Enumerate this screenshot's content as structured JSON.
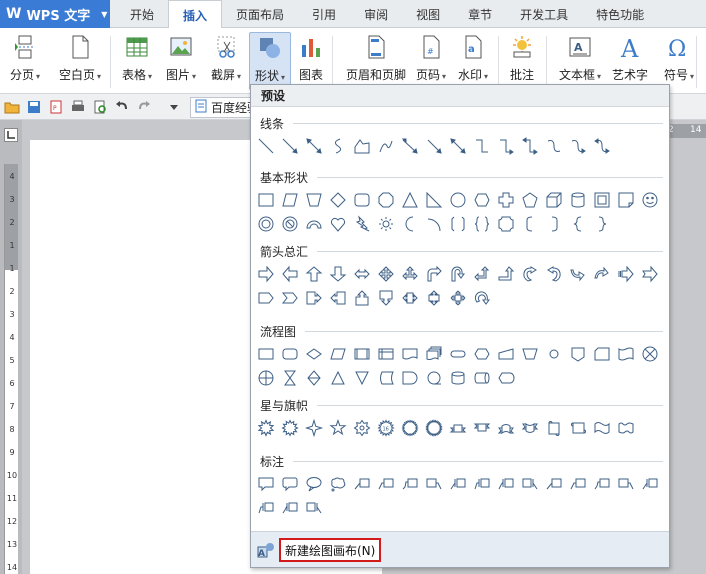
{
  "app": {
    "title": "WPS 文字"
  },
  "tabs": [
    "开始",
    "插入",
    "页面布局",
    "引用",
    "审阅",
    "视图",
    "章节",
    "开发工具",
    "特色功能"
  ],
  "active_tab": "插入",
  "ribbon": [
    {
      "label": "分页",
      "dropdown": true,
      "icon": "page-break-icon"
    },
    {
      "label": "空白页",
      "dropdown": true,
      "icon": "blank-page-icon"
    },
    {
      "label": "表格",
      "dropdown": true,
      "icon": "table-icon"
    },
    {
      "label": "图片",
      "dropdown": true,
      "icon": "picture-icon"
    },
    {
      "label": "截屏",
      "dropdown": true,
      "icon": "scissors-icon"
    },
    {
      "label": "形状",
      "dropdown": true,
      "icon": "shapes-icon"
    },
    {
      "label": "图表",
      "dropdown": false,
      "icon": "chart-icon"
    },
    {
      "label": "页眉和页脚",
      "dropdown": false,
      "icon": "header-footer-icon"
    },
    {
      "label": "页码",
      "dropdown": true,
      "icon": "page-number-icon"
    },
    {
      "label": "水印",
      "dropdown": true,
      "icon": "watermark-icon"
    },
    {
      "label": "批注",
      "dropdown": false,
      "icon": "comment-icon"
    },
    {
      "label": "文本框",
      "dropdown": true,
      "icon": "textbox-icon"
    },
    {
      "label": "艺术字",
      "dropdown": false,
      "icon": "wordart-icon"
    },
    {
      "label": "符号",
      "dropdown": true,
      "icon": "symbol-icon"
    }
  ],
  "quick_access": {
    "doc_tab": "百度经验"
  },
  "ruler": {
    "vertical_numbers": [
      "4",
      "3",
      "2",
      "1",
      "1",
      "2",
      "3",
      "4",
      "5",
      "6",
      "7",
      "8",
      "9",
      "10",
      "11",
      "12",
      "13",
      "14"
    ],
    "horizontal_numbers": [
      "2",
      "14"
    ]
  },
  "shapes_menu": {
    "header": "预设",
    "sections": [
      {
        "title": "线条",
        "icons": [
          "line-icon",
          "arrow-line-icon",
          "double-arrow-line-icon",
          "curve-icon",
          "freeform-icon",
          "scribble-icon",
          "elbow-connector-icon",
          "elbow-arrow-connector-icon",
          "elbow-double-arrow-connector-icon",
          "curved-connector-icon",
          "curved-arrow-connector-icon",
          "curved-double-arrow-connector-icon",
          "curve-connector-icon",
          "curve-arrow-connector-icon",
          "curve-double-arrow-connector-icon"
        ]
      },
      {
        "title": "基本形状",
        "icons": [
          "rectangle-icon",
          "parallelogram-icon",
          "trapezoid-icon",
          "diamond-icon",
          "rounded-rectangle-icon",
          "octagon-icon",
          "triangle-icon",
          "right-triangle-icon",
          "ellipse-icon",
          "hexagon-icon",
          "cross-icon",
          "pentagon-icon",
          "cube-icon",
          "can-icon",
          "frame-icon",
          "folded-corner-icon",
          "smiley-icon",
          "donut-icon",
          "no-symbol-icon",
          "block-arc-icon",
          "heart-icon",
          "lightning-icon",
          "sun-icon",
          "moon-icon",
          "arc-icon",
          "double-bracket-icon",
          "double-brace-icon",
          "plaque-icon",
          "left-bracket-icon",
          "right-bracket-icon",
          "left-brace-icon",
          "right-brace-icon"
        ]
      },
      {
        "title": "箭头总汇",
        "icons": [
          "right-arrow-icon",
          "left-arrow-icon",
          "up-arrow-icon",
          "down-arrow-icon",
          "left-right-arrow-icon",
          "quad-arrow-icon",
          "left-right-up-arrow-icon",
          "bent-arrow-icon",
          "u-turn-arrow-icon",
          "left-up-arrow-icon",
          "bent-up-arrow-icon",
          "curved-right-arrow-icon",
          "curved-left-arrow-icon",
          "curved-up-arrow-icon",
          "curved-down-arrow-icon",
          "striped-right-arrow-icon",
          "notched-right-arrow-icon",
          "pentagon-arrow-icon",
          "chevron-icon",
          "right-arrow-callout-icon",
          "left-arrow-callout-icon",
          "up-arrow-callout-icon",
          "down-arrow-callout-icon",
          "left-right-arrow-callout-icon",
          "up-down-arrow-callout-icon",
          "quad-arrow-callout-icon",
          "circular-arrow-icon"
        ]
      },
      {
        "title": "流程图",
        "icons": [
          "flow-process-icon",
          "flow-alternate-process-icon",
          "flow-decision-icon",
          "flow-data-icon",
          "flow-predefined-process-icon",
          "flow-internal-storage-icon",
          "flow-document-icon",
          "flow-multidocument-icon",
          "flow-terminator-icon",
          "flow-preparation-icon",
          "flow-manual-input-icon",
          "flow-manual-operation-icon",
          "flow-connector-icon",
          "flow-offpage-connector-icon",
          "flow-card-icon",
          "flow-punched-tape-icon",
          "flow-summing-junction-icon",
          "flow-or-icon",
          "flow-collate-icon",
          "flow-sort-icon",
          "flow-extract-icon",
          "flow-merge-icon",
          "flow-stored-data-icon",
          "flow-delay-icon",
          "flow-sequential-storage-icon",
          "flow-magnetic-disk-icon",
          "flow-direct-access-storage-icon",
          "flow-display-icon"
        ]
      },
      {
        "title": "星与旗帜",
        "icons": [
          "explosion1-icon",
          "explosion2-icon",
          "star4-icon",
          "star5-icon",
          "star8-icon",
          "star16-icon",
          "star24-icon",
          "star32-icon",
          "ribbon-up-icon",
          "ribbon-down-icon",
          "curved-ribbon-up-icon",
          "curved-ribbon-down-icon",
          "vertical-scroll-icon",
          "horizontal-scroll-icon",
          "wave-icon",
          "double-wave-icon"
        ]
      },
      {
        "title": "标注",
        "icons": [
          "rect-callout-icon",
          "rounded-rect-callout-icon",
          "oval-callout-icon",
          "cloud-callout-icon",
          "line-callout1-icon",
          "line-callout2-icon",
          "line-callout3-icon",
          "line-callout4-icon",
          "accent-callout1-icon",
          "accent-callout2-icon",
          "accent-callout3-icon",
          "accent-callout4-icon",
          "border-callout1-icon",
          "border-callout2-icon",
          "border-callout3-icon",
          "border-callout4-icon",
          "accent-border-callout1-icon",
          "accent-border-callout2-icon",
          "accent-border-callout3-icon",
          "accent-border-callout4-icon"
        ]
      }
    ],
    "footer": {
      "label": "新建绘图画布(N)",
      "icon": "drawing-canvas-icon"
    }
  },
  "colors": {
    "accent": "#3a7bd5",
    "highlight": "#d21a1a",
    "icon_stroke": "#3d5f86"
  }
}
